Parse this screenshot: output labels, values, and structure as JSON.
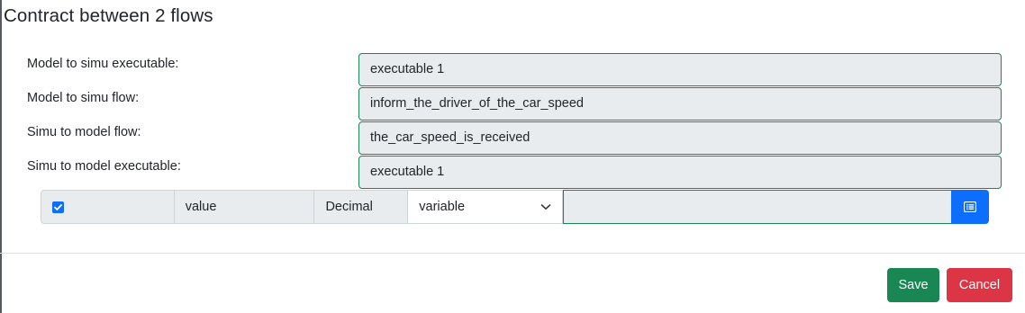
{
  "modal": {
    "title": "Contract between 2 flows"
  },
  "form": {
    "rows": [
      {
        "label": "Model to simu executable:",
        "value": "executable 1"
      },
      {
        "label": "Model to simu flow:",
        "value": "inform_the_driver_of_the_car_speed"
      },
      {
        "label": "Simu to model flow:",
        "value": "the_car_speed_is_received"
      },
      {
        "label": "Simu to model executable:",
        "value": "executable 1"
      }
    ]
  },
  "variable_row": {
    "checked": true,
    "name": "value",
    "type": "Decimal",
    "select_value": "variable",
    "input_value": ""
  },
  "footer": {
    "save_label": "Save",
    "cancel_label": "Cancel"
  },
  "colors": {
    "success": "#198754",
    "danger": "#dc3545",
    "primary": "#0d6efd",
    "readonly_bg": "#e9ecef"
  },
  "icons": {
    "checkbox": "check-icon",
    "select": "chevron-down-icon",
    "list_button": "list-icon"
  }
}
